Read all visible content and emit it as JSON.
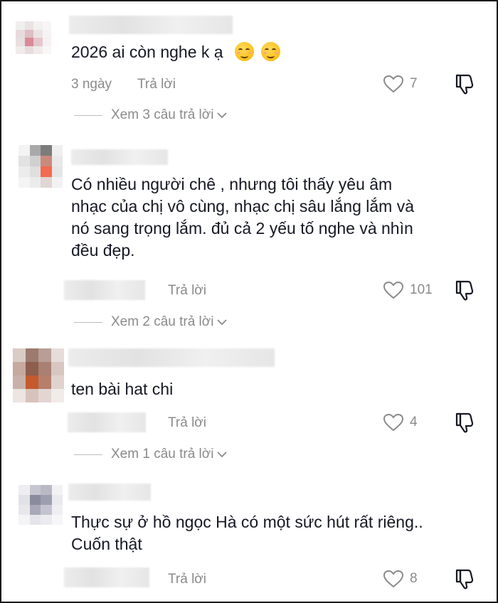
{
  "comments": [
    {
      "text": "2026 ai còn nghe k ạ",
      "emojis": [
        "smiling-face-icon",
        "smiling-face-icon"
      ],
      "time": "3 ngày",
      "reply_label": "Trả lời",
      "likes": "7",
      "view_replies": "Xem 3 câu trả lời"
    },
    {
      "lines": [
        "Có nhiều người chê , nhưng tôi thấy yêu âm",
        "nhạc của chị vô cùng, nhạc chị sâu lắng lắm và",
        "nó sang trọng lắm. đủ cả 2 yếu tố nghe và nhìn",
        "đều đẹp."
      ],
      "reply_label": "Trả lời",
      "likes": "101",
      "view_replies": "Xem 2 câu trả lời"
    },
    {
      "text": "ten bài hat chi",
      "reply_label": "Trả lời",
      "likes": "4",
      "view_replies": "Xem 1 câu trả lời"
    },
    {
      "lines": [
        "Thực sự ở hồ ngọc Hà có một sức hút rất riêng..",
        "Cuốn thật"
      ],
      "reply_label": "Trả lời",
      "likes": "8"
    }
  ],
  "colors": {
    "text": "#161823",
    "meta": "#8a8a8a",
    "divider": "#bdbdbd"
  }
}
